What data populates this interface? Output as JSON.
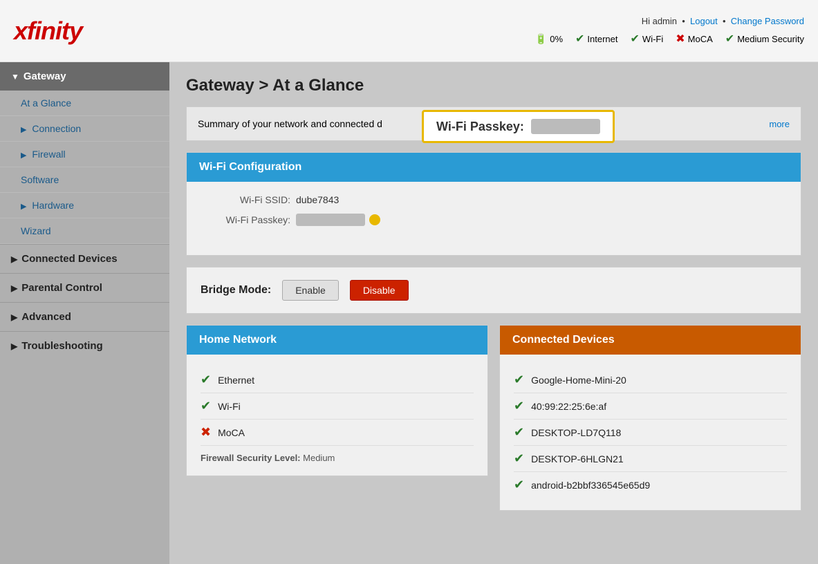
{
  "header": {
    "logo": "xfinity",
    "user_greeting": "Hi admin",
    "logout_label": "Logout",
    "change_password_label": "Change Password",
    "status_items": [
      {
        "id": "battery",
        "label": "0%",
        "icon": "battery",
        "ok": true
      },
      {
        "id": "internet",
        "label": "Internet",
        "icon": "check",
        "ok": true
      },
      {
        "id": "wifi",
        "label": "Wi-Fi",
        "icon": "check",
        "ok": true
      },
      {
        "id": "moca",
        "label": "MoCA",
        "icon": "x",
        "ok": false
      },
      {
        "id": "security",
        "label": "Medium Security",
        "icon": "check",
        "ok": true
      }
    ]
  },
  "sidebar": {
    "sections": [
      {
        "id": "gateway",
        "label": "Gateway",
        "expanded": true,
        "items": [
          {
            "id": "at-a-glance",
            "label": "At a Glance",
            "active": true
          },
          {
            "id": "connection",
            "label": "Connection",
            "has_arrow": true
          },
          {
            "id": "firewall",
            "label": "Firewall",
            "has_arrow": true
          },
          {
            "id": "software",
            "label": "Software"
          },
          {
            "id": "hardware",
            "label": "Hardware",
            "has_arrow": true
          },
          {
            "id": "wizard",
            "label": "Wizard"
          }
        ]
      },
      {
        "id": "connected-devices",
        "label": "Connected Devices",
        "has_arrow": true
      },
      {
        "id": "parental-control",
        "label": "Parental Control",
        "has_arrow": true
      },
      {
        "id": "advanced",
        "label": "Advanced",
        "has_arrow": true
      },
      {
        "id": "troubleshooting",
        "label": "Troubleshooting",
        "has_arrow": true
      }
    ]
  },
  "page": {
    "title": "Gateway > At a Glance",
    "summary_text": "Summary of your network and connected d",
    "more_link": "more",
    "wifi_callout": {
      "label": "Wi-Fi Passkey:"
    },
    "wifi_config": {
      "header": "Wi-Fi Configuration",
      "ssid_label": "Wi-Fi SSID:",
      "ssid_value": "dube7843",
      "passkey_label": "Wi-Fi Passkey:"
    },
    "bridge_mode": {
      "label": "Bridge Mode:",
      "enable_label": "Enable",
      "disable_label": "Disable"
    },
    "home_network": {
      "header": "Home Network",
      "items": [
        {
          "label": "Ethernet",
          "ok": true
        },
        {
          "label": "Wi-Fi",
          "ok": true
        },
        {
          "label": "MoCA",
          "ok": false
        }
      ],
      "firewall_label": "Firewall Security Level:",
      "firewall_value": "Medium"
    },
    "connected_devices": {
      "header": "Connected Devices",
      "devices": [
        {
          "label": "Google-Home-Mini-20",
          "ok": true
        },
        {
          "label": "40:99:22:25:6e:af",
          "ok": true
        },
        {
          "label": "DESKTOP-LD7Q118",
          "ok": true
        },
        {
          "label": "DESKTOP-6HLGN21",
          "ok": true
        },
        {
          "label": "android-b2bbf336545e65d9",
          "ok": true
        }
      ]
    }
  }
}
